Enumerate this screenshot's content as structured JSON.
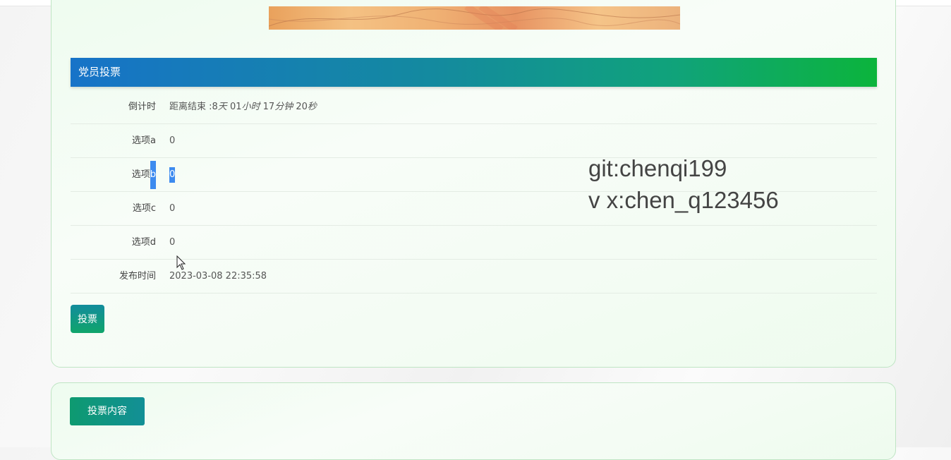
{
  "vote_section": {
    "header_title": "党员投票",
    "rows": [
      {
        "label": "倒计时",
        "countdown": {
          "prefix": "距离结束 :",
          "days": "8",
          "days_unit": "天",
          "hours": " 01",
          "hours_unit": "小时",
          "minutes": " 17",
          "minutes_unit": "分钟",
          "seconds": " 20",
          "seconds_unit": "秒"
        }
      },
      {
        "label_text": "选项",
        "label_suffix": "a",
        "value": "0"
      },
      {
        "label_text": "选项",
        "label_suffix": "b",
        "value": "0"
      },
      {
        "label_text": "选项",
        "label_suffix": "c",
        "value": "0"
      },
      {
        "label_text": "选项",
        "label_suffix": "d",
        "value": "0"
      },
      {
        "label": "发布时间",
        "value": "2023-03-08 22:35:58"
      }
    ],
    "vote_button": "投票"
  },
  "content_section": {
    "button_label": "投票内容"
  },
  "watermark": {
    "line1": "git:chenqi199",
    "line2": "v x:chen_q123456"
  },
  "colors": {
    "header_start": "#1773c8",
    "header_end": "#0cb43c",
    "selection": "#3d8bef"
  }
}
